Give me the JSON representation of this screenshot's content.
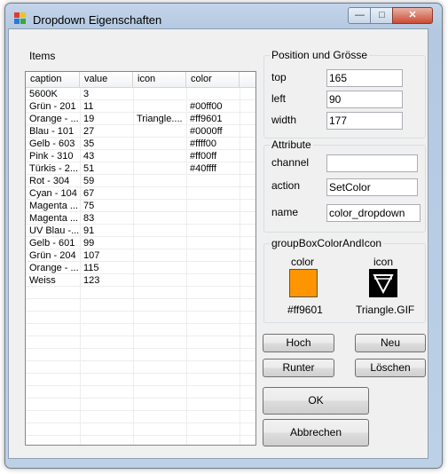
{
  "window": {
    "title": "Dropdown Eigenschaften"
  },
  "titlebar_buttons": {
    "minimize": "—",
    "maximize": "□",
    "close": "✕"
  },
  "items_label": "Items",
  "columns": [
    "caption",
    "value",
    "icon",
    "color"
  ],
  "rows": [
    [
      "5600K",
      "3",
      "",
      ""
    ],
    [
      "Grün - 201",
      "11",
      "",
      "#00ff00"
    ],
    [
      "Orange - ...",
      "19",
      "Triangle....",
      "#ff9601"
    ],
    [
      "Blau - 101",
      "27",
      "",
      "#0000ff"
    ],
    [
      "Gelb - 603",
      "35",
      "",
      "#ffff00"
    ],
    [
      "Pink - 310",
      "43",
      "",
      "#ff00ff"
    ],
    [
      "Türkis - 2...",
      "51",
      "",
      "#40ffff"
    ],
    [
      "Rot - 304",
      "59",
      "",
      ""
    ],
    [
      "Cyan - 104",
      "67",
      "",
      ""
    ],
    [
      "Magenta ...",
      "75",
      "",
      ""
    ],
    [
      "Magenta ...",
      "83",
      "",
      ""
    ],
    [
      "UV Blau -...",
      "91",
      "",
      ""
    ],
    [
      "Gelb - 601",
      "99",
      "",
      ""
    ],
    [
      "Grün - 204",
      "107",
      "",
      ""
    ],
    [
      "Orange - ...",
      "115",
      "",
      ""
    ],
    [
      "Weiss",
      "123",
      "",
      ""
    ]
  ],
  "position_group": {
    "title": "Position und Grösse",
    "top_label": "top",
    "top_value": "165",
    "left_label": "left",
    "left_value": "90",
    "width_label": "width",
    "width_value": "177"
  },
  "attribute_group": {
    "title": "Attribute",
    "channel_label": "channel",
    "channel_value": "",
    "action_label": "action",
    "action_value": "SetColor",
    "name_label": "name",
    "name_value": "color_dropdown"
  },
  "color_icon_group": {
    "title": "groupBoxColorAndIcon",
    "color_label": "color",
    "icon_label": "icon",
    "color_value": "#ff9601",
    "icon_value": "Triangle.GIF",
    "swatch_color": "#ff9601"
  },
  "buttons": {
    "up": "Hoch",
    "new": "Neu",
    "down": "Runter",
    "delete": "Löschen",
    "ok": "OK",
    "cancel": "Abbrechen"
  }
}
